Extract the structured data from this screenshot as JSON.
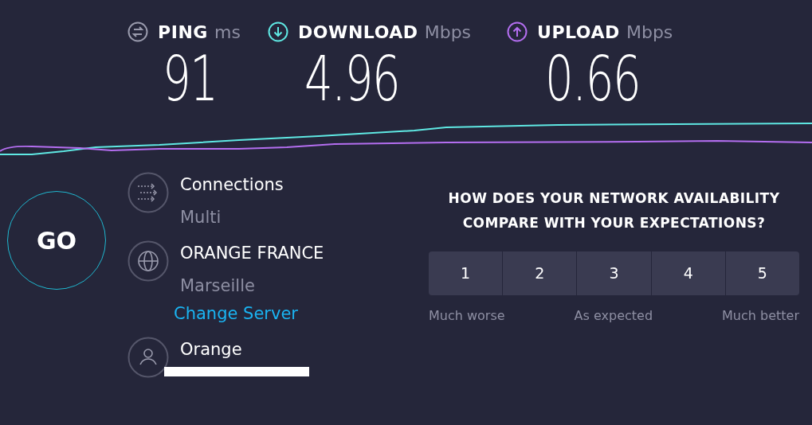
{
  "metrics": [
    {
      "kind": "ping",
      "label": "PING",
      "unit": "ms",
      "value": "91",
      "color": "#9a9bad"
    },
    {
      "kind": "download",
      "label": "DOWNLOAD",
      "unit": "Mbps",
      "value": "4.96",
      "color": "#5fe8e3"
    },
    {
      "kind": "upload",
      "label": "UPLOAD",
      "unit": "Mbps",
      "value": "0.66",
      "color": "#b46ef0"
    }
  ],
  "go_button": "GO",
  "details": [
    {
      "kind": "connections",
      "title": "Connections",
      "subtitle": "Multi"
    },
    {
      "kind": "server",
      "title": "ORANGE FRANCE",
      "subtitle": "Marseille",
      "link": "Change Server"
    },
    {
      "kind": "provider",
      "title": "Orange",
      "redacted": true
    }
  ],
  "survey": {
    "question": "HOW DOES YOUR NETWORK AVAILABILITY COMPARE WITH YOUR EXPECTATIONS?",
    "options": [
      {
        "label": "1",
        "selected": false
      },
      {
        "label": "2",
        "selected": false
      },
      {
        "label": "3",
        "selected": false
      },
      {
        "label": "4",
        "selected": false
      },
      {
        "label": "5",
        "selected": false
      }
    ],
    "scale_labels": [
      "Much worse",
      "As expected",
      "Much better"
    ]
  }
}
